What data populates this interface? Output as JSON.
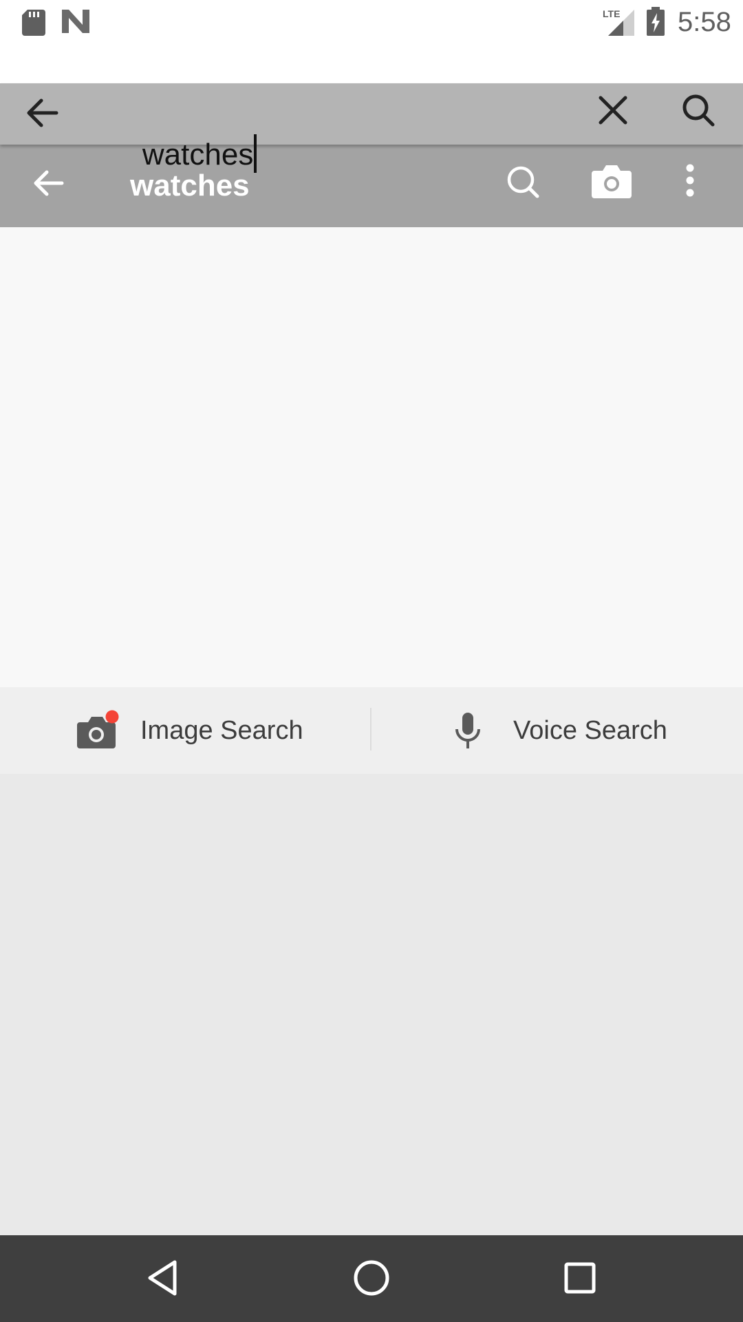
{
  "status_bar": {
    "time": "5:58",
    "network_label": "LTE",
    "icons": [
      "sd-card-icon",
      "n-logo-icon",
      "lte-signal-icon",
      "battery-charging-icon"
    ]
  },
  "search_bar": {
    "query": "watches",
    "icons": {
      "back": "arrow-left-icon",
      "clear": "close-icon",
      "search": "search-icon"
    }
  },
  "app_toolbar": {
    "title": "watches",
    "icons": {
      "back": "arrow-left-icon",
      "search": "search-icon",
      "camera": "camera-icon",
      "more": "more-vert-icon"
    }
  },
  "search_options": {
    "image_search_label": "Image Search",
    "voice_search_label": "Voice Search",
    "badge_color": "#f44336"
  },
  "nav_bar": {
    "icons": [
      "nav-back-icon",
      "nav-home-icon",
      "nav-recents-icon"
    ]
  },
  "colors": {
    "search_bar_bg": "#b4b4b4",
    "toolbar_bg": "#a3a3a3",
    "nav_bar_bg": "#3f3f3f"
  }
}
